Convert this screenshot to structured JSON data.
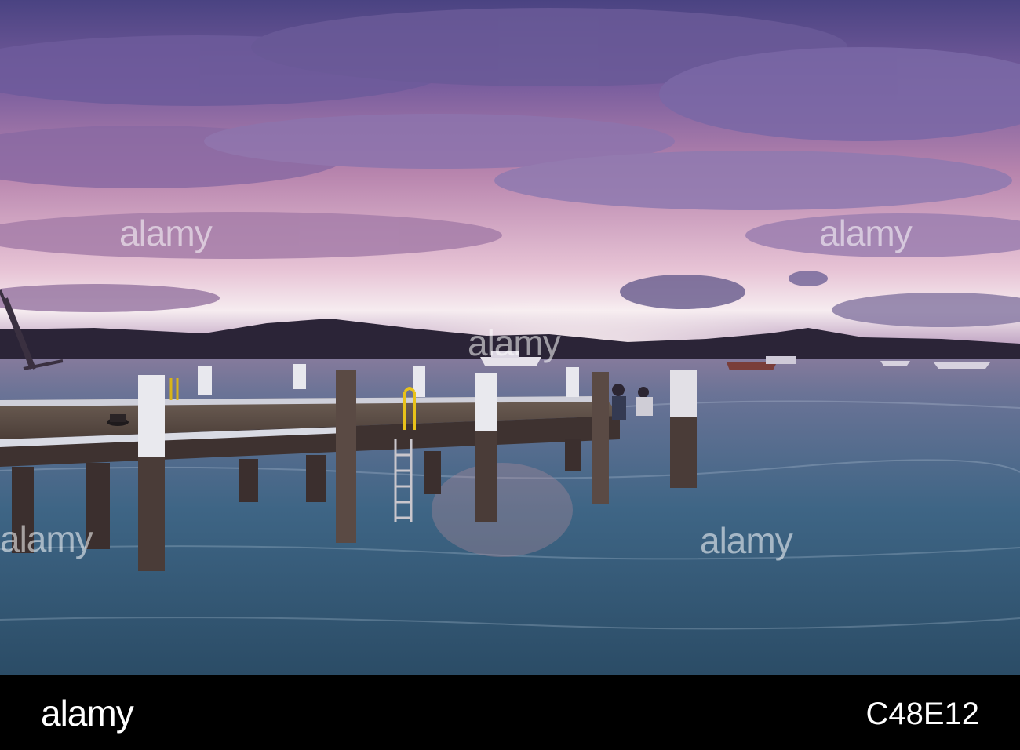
{
  "photo": {
    "watermark": "alamy",
    "colors": {
      "sky_top": "#5a4f8f",
      "sky_pink": "#c78fb8",
      "horizon_glow": "#f2e6ee",
      "hills": "#2a2436",
      "water_deep": "#2f4a66",
      "water_light": "#4d7796",
      "pier": "#4a3a36"
    }
  },
  "footer": {
    "logo": "alamy",
    "image_id": "C48E12"
  }
}
